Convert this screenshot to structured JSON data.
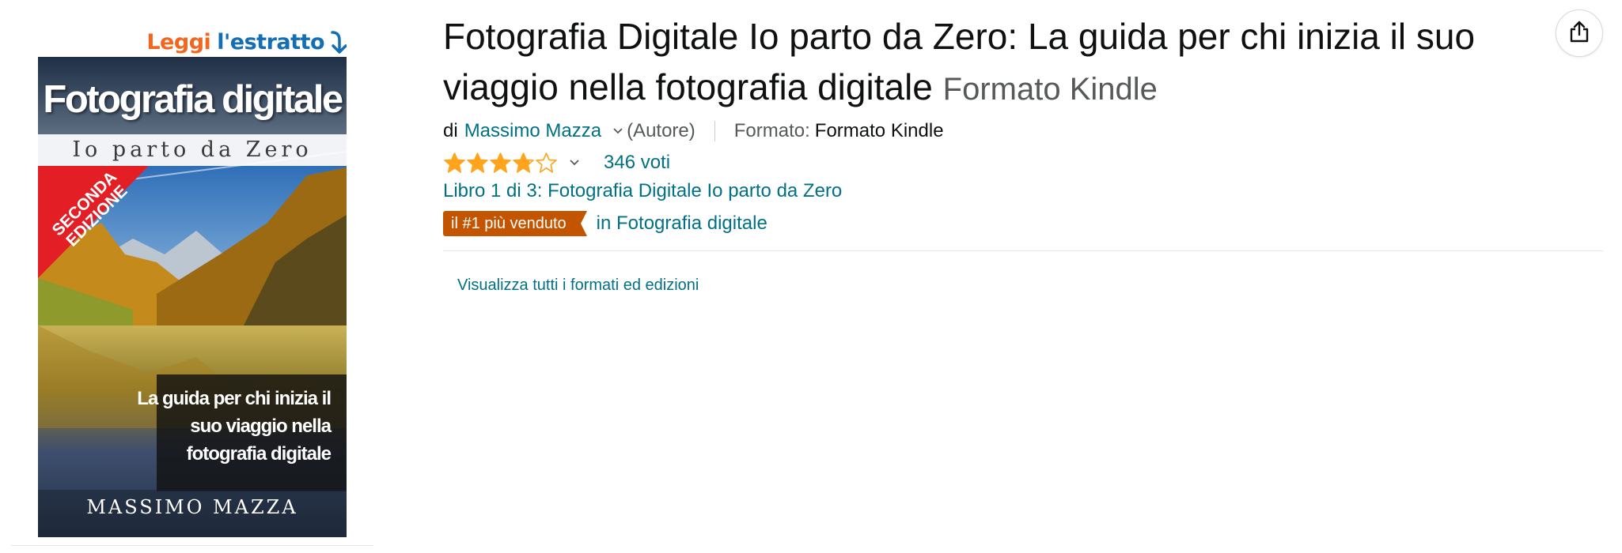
{
  "look_inside": {
    "word1": "Leggi",
    "word2": "l'estratto",
    "icon": "arrow-down-icon"
  },
  "cover": {
    "title": "Fotografia digitale",
    "subtitle": "Io parto da Zero",
    "badge": "SECONDA\nEDIZIONE",
    "tagline": "La guida per chi inizia il\nsuo viaggio nella\nfotografia digitale",
    "author": "MASSIMO MAZZA"
  },
  "product": {
    "title": "Fotografia Digitale Io parto da Zero: La guida per chi inizia il suo viaggio nella fotografia digitale",
    "format_suffix": "Formato Kindle"
  },
  "byline": {
    "prefix": "di",
    "author": "Massimo Mazza",
    "role": "(Autore)",
    "format_label": "Formato:",
    "format_value": "Formato Kindle"
  },
  "rating": {
    "stars": 3.8,
    "max": 5,
    "count": "346 voti",
    "star_color": "#ffa41c"
  },
  "series": "Libro 1 di 3: Fotografia Digitale Io parto da Zero",
  "bestseller": {
    "badge": "il #1 più venduto",
    "category": "in Fotografia digitale",
    "badge_color": "#c45500"
  },
  "all_formats": "Visualizza tutti i formati ed edizioni",
  "share": {
    "icon": "share-icon"
  },
  "colors": {
    "link": "#007185",
    "text": "#0f1111",
    "muted": "#565959"
  }
}
